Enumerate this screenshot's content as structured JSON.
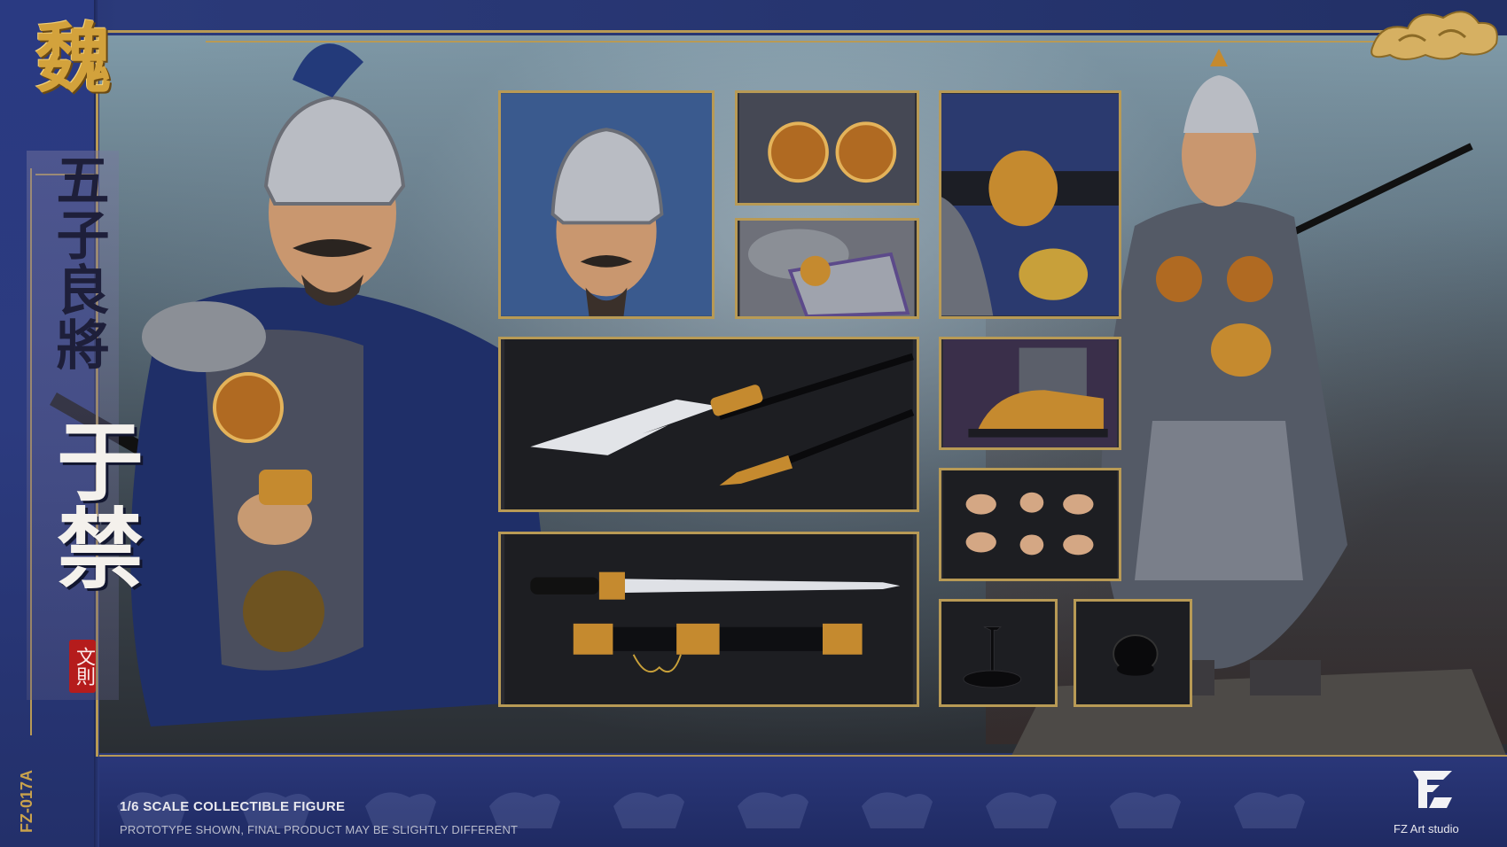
{
  "poster": {
    "faction_glyph": "魏",
    "title_vertical": "五子良將",
    "character_name": "于禁",
    "courtesy_seal": "文則",
    "product_code": "FZ-017A",
    "scale_line": "1/6 SCALE COLLECTIBLE FIGURE",
    "disclaimer": "PROTOTYPE SHOWN, FINAL PRODUCT MAY BE SLIGHTLY DIFFERENT",
    "studio_name": "FZ Art studio",
    "studio_logo": "FZ"
  },
  "colors": {
    "navy_background": "#25316d",
    "gold_frame": "#b89a55",
    "seal_red": "#b51c1c",
    "name_white": "#f4f1ec"
  },
  "detail_photos": [
    {
      "name": "helmeted-head-closeup"
    },
    {
      "name": "chest-armor-closeup"
    },
    {
      "name": "shoulder-armor-closeup"
    },
    {
      "name": "lion-belt-buckle-closeup"
    },
    {
      "name": "spear-heads"
    },
    {
      "name": "boot-closeup"
    },
    {
      "name": "sword-and-scabbard"
    },
    {
      "name": "interchangeable-hands"
    },
    {
      "name": "figure-stand"
    },
    {
      "name": "hair-bun-accessory"
    }
  ]
}
